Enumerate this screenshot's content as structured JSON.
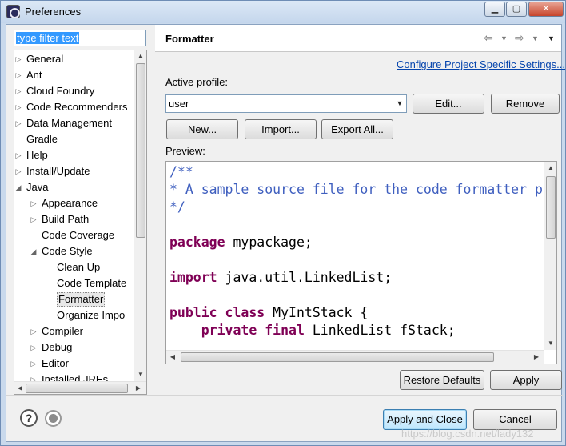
{
  "window": {
    "title": "Preferences"
  },
  "filter": {
    "value": "type filter text"
  },
  "tree": [
    {
      "label": "General",
      "twisty": "▷"
    },
    {
      "label": "Ant",
      "twisty": "▷"
    },
    {
      "label": "Cloud Foundry",
      "twisty": "▷"
    },
    {
      "label": "Code Recommenders",
      "twisty": "▷"
    },
    {
      "label": "Data Management",
      "twisty": "▷"
    },
    {
      "label": "Gradle",
      "twisty": ""
    },
    {
      "label": "Help",
      "twisty": "▷"
    },
    {
      "label": "Install/Update",
      "twisty": "▷"
    },
    {
      "label": "Java",
      "twisty": "◢"
    },
    {
      "label": "Appearance",
      "twisty": "▷"
    },
    {
      "label": "Build Path",
      "twisty": "▷"
    },
    {
      "label": "Code Coverage",
      "twisty": ""
    },
    {
      "label": "Code Style",
      "twisty": "◢"
    },
    {
      "label": "Clean Up",
      "twisty": ""
    },
    {
      "label": "Code Template",
      "twisty": ""
    },
    {
      "label": "Formatter",
      "twisty": "",
      "selected": true
    },
    {
      "label": "Organize Impo",
      "twisty": ""
    },
    {
      "label": "Compiler",
      "twisty": "▷"
    },
    {
      "label": "Debug",
      "twisty": "▷"
    },
    {
      "label": "Editor",
      "twisty": "▷"
    },
    {
      "label": "Installed JREs",
      "twisty": "▷"
    }
  ],
  "page": {
    "title": "Formatter",
    "configure_link": "Configure Project Specific Settings...",
    "active_profile_label": "Active profile:",
    "profile_value": "user",
    "edit_button": "Edit...",
    "remove_button": "Remove",
    "new_button": "New...",
    "import_button": "Import...",
    "export_button": "Export All...",
    "preview_label": "Preview:",
    "restore_defaults_button": "Restore Defaults",
    "apply_button": "Apply"
  },
  "code": [
    [
      [
        "c-comment",
        "/**"
      ]
    ],
    [
      [
        "c-comment",
        "* A sample source file for the code formatter pr"
      ]
    ],
    [
      [
        "c-comment",
        "*/"
      ]
    ],
    [],
    [
      [
        "c-kw",
        "package"
      ],
      [
        "",
        " mypackage;"
      ]
    ],
    [],
    [
      [
        "c-kw",
        "import"
      ],
      [
        "",
        " java.util.LinkedList;"
      ]
    ],
    [],
    [
      [
        "c-kw",
        "public"
      ],
      [
        "",
        " "
      ],
      [
        "c-kw",
        "class"
      ],
      [
        "",
        " MyIntStack {"
      ]
    ],
    [
      [
        "",
        "    "
      ],
      [
        "c-kw",
        "private"
      ],
      [
        "",
        " "
      ],
      [
        "c-kw",
        "final"
      ],
      [
        "",
        " LinkedList fStack;"
      ]
    ]
  ],
  "footer": {
    "apply_close_button": "Apply and Close",
    "cancel_button": "Cancel",
    "watermark": "https://blog.csdn.net/lady132"
  }
}
